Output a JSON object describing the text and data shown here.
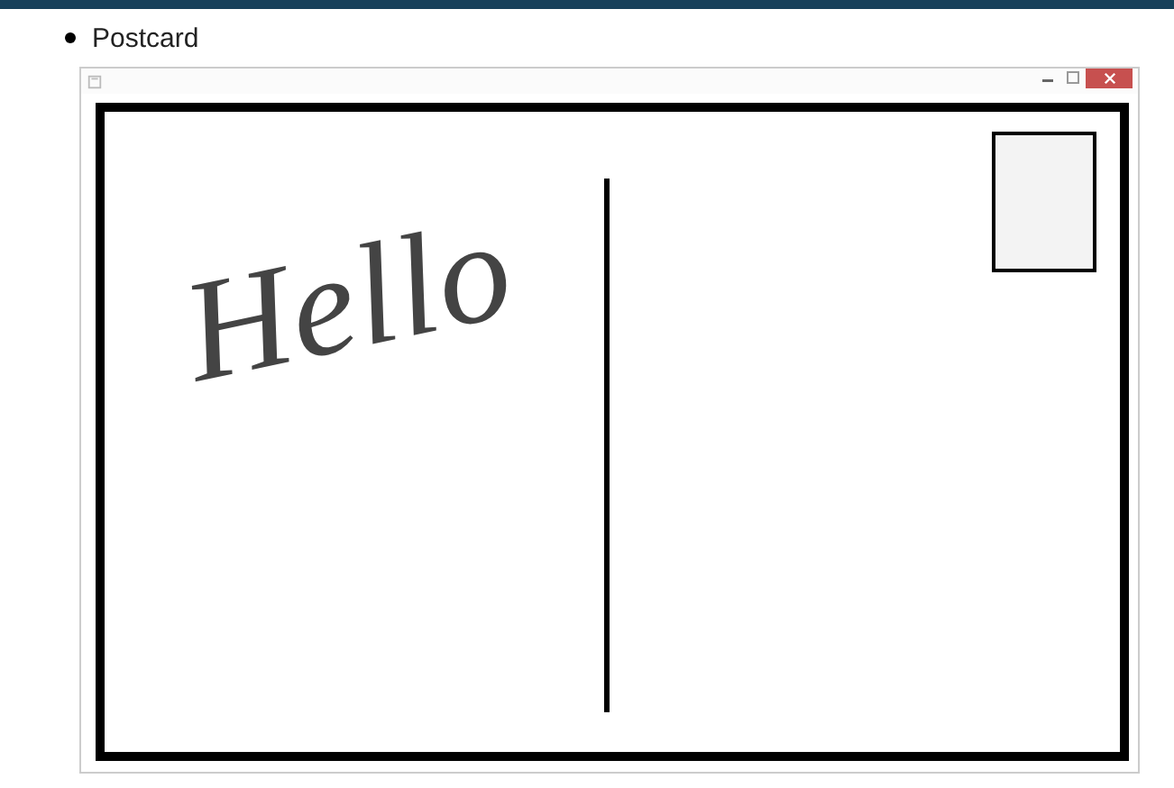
{
  "bullet": "Postcard",
  "window": {
    "buttons": [
      {
        "kind": "minimize"
      },
      {
        "kind": "maximize"
      },
      {
        "kind": "close"
      }
    ]
  },
  "canvas": {
    "handwriting": "Hello"
  }
}
